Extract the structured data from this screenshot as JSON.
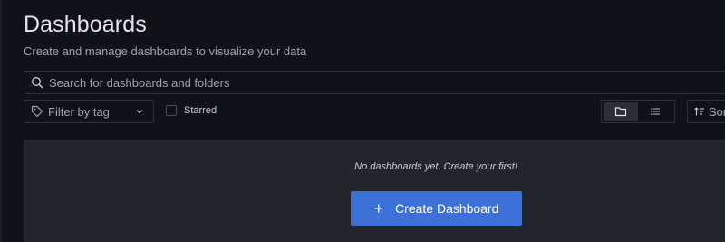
{
  "header": {
    "title": "Dashboards",
    "subtitle": "Create and manage dashboards to visualize your data"
  },
  "search": {
    "placeholder": "Search for dashboards and folders",
    "value": "",
    "icon": "search-icon"
  },
  "filters": {
    "tag_filter_label": "Filter by tag",
    "starred_label": "Starred",
    "starred_checked": false,
    "sort_label": "Sort"
  },
  "view_toggle": {
    "options": [
      "folder-view",
      "list-view"
    ],
    "active": "folder-view"
  },
  "empty_state": {
    "message": "No dashboards yet. Create your first!",
    "create_button_label": "Create Dashboard",
    "create_button_icon": "plus-icon"
  },
  "colors": {
    "background": "#111217",
    "panel": "#22252b",
    "primary_button": "#3d71d9",
    "border": "#2f3138"
  }
}
